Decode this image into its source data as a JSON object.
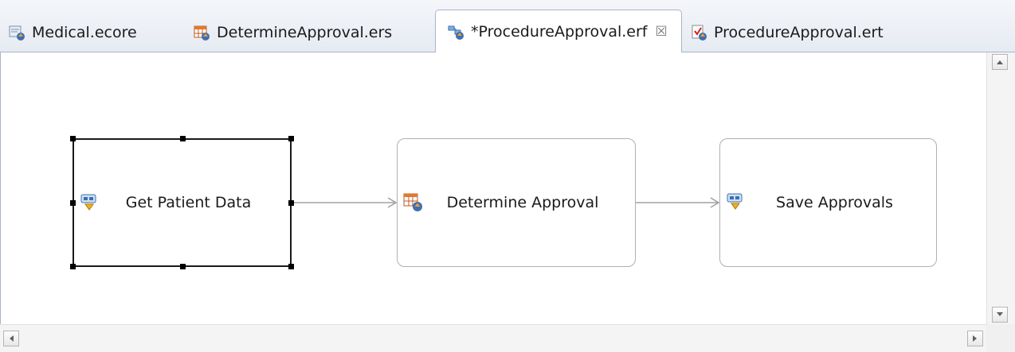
{
  "tabs": [
    {
      "label": "Medical.ecore",
      "icon": "ecore-model-icon"
    },
    {
      "label": "DetermineApproval.ers",
      "icon": "rule-set-icon"
    },
    {
      "label": "*ProcedureApproval.erf",
      "icon": "rule-flow-icon",
      "active": true,
      "close": "☒"
    },
    {
      "label": "ProcedureApproval.ert",
      "icon": "rule-test-icon"
    }
  ],
  "nodes": [
    {
      "label": "Get Patient Data",
      "icon": "action-icon",
      "selected": true
    },
    {
      "label": "Determine Approval",
      "icon": "rule-set-icon",
      "selected": false
    },
    {
      "label": "Save Approvals",
      "icon": "action-icon",
      "selected": false
    }
  ],
  "colors": {
    "tab_border": "#a9b5c6",
    "node_border": "#b0b0b0",
    "connector": "#a0a0a0"
  }
}
